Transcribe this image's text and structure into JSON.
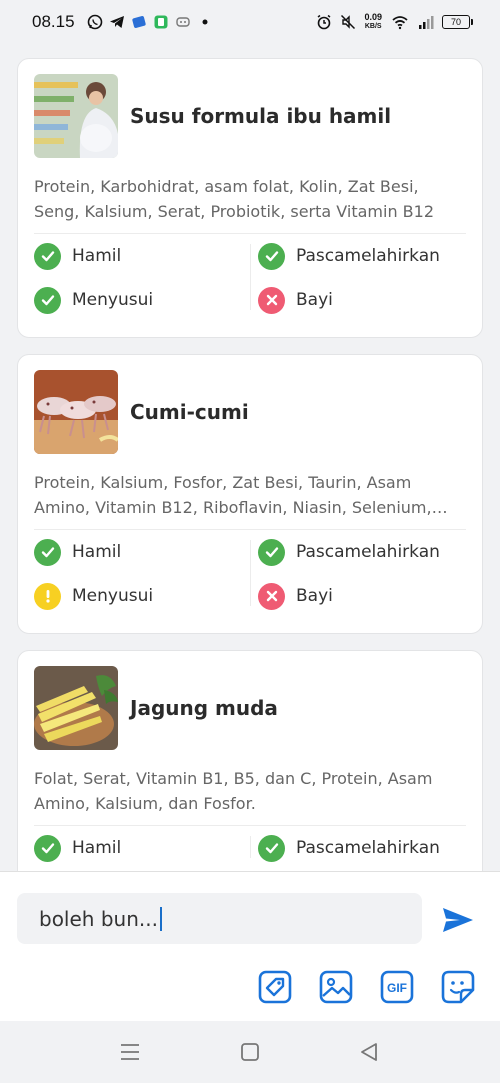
{
  "status_bar": {
    "time": "08.15",
    "net_speed_value": "0.09",
    "net_speed_unit": "KB/S",
    "battery": "70",
    "icons": [
      "whatsapp-icon",
      "telegram-icon",
      "app-icon",
      "app-icon",
      "game-icon",
      "dot-icon",
      "alarm-icon",
      "mute-icon",
      "wifi-icon",
      "signal-icon",
      "battery-icon"
    ]
  },
  "cards": [
    {
      "title": "Susu formula ibu hamil",
      "description": "Protein, Karbohidrat, asam folat, Kolin, Zat Besi, Seng, Kalsium, Serat, Probiotik, serta Vitamin B12",
      "statuses": [
        {
          "label": "Hamil",
          "state": "ok"
        },
        {
          "label": "Pascamelahirkan",
          "state": "ok"
        },
        {
          "label": "Menyusui",
          "state": "ok"
        },
        {
          "label": "Bayi",
          "state": "no"
        }
      ]
    },
    {
      "title": "Cumi-cumi",
      "description": "Protein, Kalsium, Fosfor, Zat Besi, Taurin, Asam Amino, Vitamin B12, Riboflavin, Niasin, Selenium,…",
      "statuses": [
        {
          "label": "Hamil",
          "state": "ok"
        },
        {
          "label": "Pascamelahirkan",
          "state": "ok"
        },
        {
          "label": "Menyusui",
          "state": "warn"
        },
        {
          "label": "Bayi",
          "state": "no"
        }
      ]
    },
    {
      "title": "Jagung muda",
      "description": "Folat, Serat, Vitamin B1, B5, dan C, Protein, Asam Amino, Kalsium, dan Fosfor.",
      "statuses": [
        {
          "label": "Hamil",
          "state": "ok"
        },
        {
          "label": "Pascamelahirkan",
          "state": "ok"
        }
      ]
    }
  ],
  "composer": {
    "input_value": "boleh bun...",
    "send_icon": "send-icon",
    "tools": [
      "tag-icon",
      "image-icon",
      "gif-icon",
      "sticker-icon"
    ],
    "gif_label": "GIF"
  },
  "colors": {
    "ok": "#4caf50",
    "warn": "#f7d022",
    "no": "#ef5b73",
    "accent": "#1a73d9"
  }
}
